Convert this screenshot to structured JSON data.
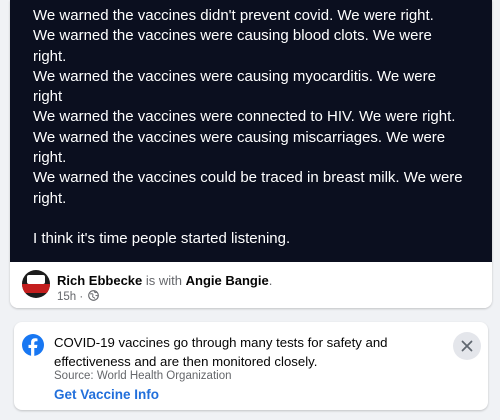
{
  "post": {
    "image_text_lines": [
      "We warned the vaccines didn't prevent covid. We were right.",
      "We warned the vaccines were causing blood clots. We were",
      "right.",
      "We warned the vaccines were causing myocarditis. We were",
      "right",
      "We warned the vaccines were connected to HIV. We were right.",
      "We warned the vaccines were causing miscarriages. We were",
      "right.",
      "We warned the vaccines could be traced in breast milk. We were",
      "right."
    ],
    "closing_line": "I think it's time people started listening.",
    "author_name": "Rich Ebbecke",
    "with_text": "is with",
    "tagged_name": "Angie Bangie",
    "period": ".",
    "time_ago": "15h",
    "separator": "·",
    "image_background_color": "#0b0f1f"
  },
  "info_notice": {
    "message": "COVID-19 vaccines go through many tests for safety and effectiveness and are then monitored closely.",
    "source": "Source: World Health Organization",
    "cta_label": "Get Vaccine Info",
    "icon": "facebook-icon",
    "close_icon": "close-icon",
    "link_color": "#216fdb",
    "brand_color": "#1877f2"
  }
}
